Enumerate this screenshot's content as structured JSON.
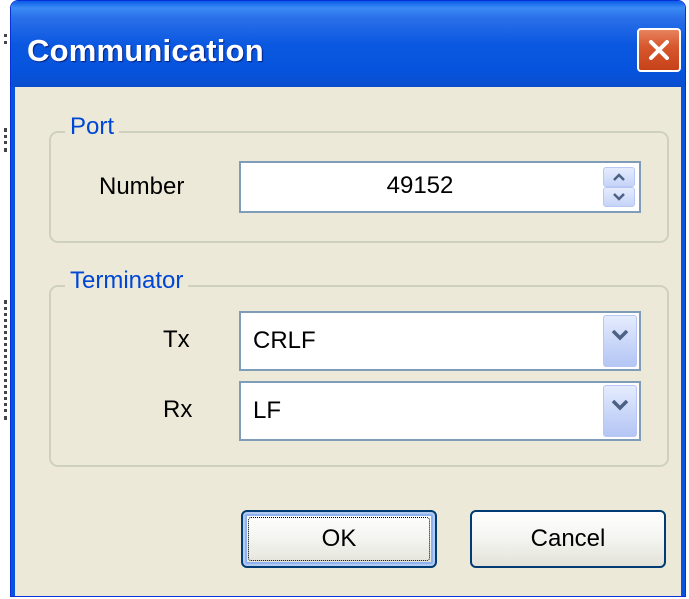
{
  "window": {
    "title": "Communication",
    "close_icon": "close-x-icon"
  },
  "port": {
    "legend": "Port",
    "number_label": "Number",
    "number_value": "49152",
    "spinner_icon": "spin-up-down-icon"
  },
  "terminator": {
    "legend": "Terminator",
    "tx_label": "Tx",
    "tx_value": "CRLF",
    "rx_label": "Rx",
    "rx_value": "LF",
    "dropdown_icon": "chevron-down-icon"
  },
  "buttons": {
    "ok_label": "OK",
    "cancel_label": "Cancel"
  },
  "colors": {
    "titlebar": "#0a4ecf",
    "legend_text": "#0046d5",
    "dialog_bg": "#ece9d8",
    "close_button": "#d8582e"
  }
}
